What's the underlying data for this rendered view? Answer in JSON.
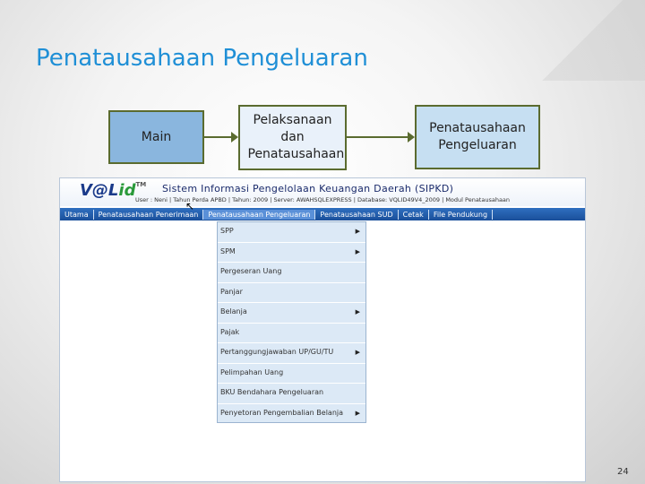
{
  "slide": {
    "title": "Penatausahaan Pengeluaran",
    "page_number": "24",
    "flow": [
      "Main",
      "Pelaksanaan dan Penatausahaan",
      "Penatausahaan Pengeluaran"
    ]
  },
  "app": {
    "logo_main": "V@L",
    "logo_accent": "id",
    "logo_tm": "TM",
    "title": "Sistem Informasi Pengelolaan Keuangan Daerah (SIPKD)",
    "user_info": "User : Neni  |  Tahun Perda APBD  |  Tahun: 2009  |  Server: AWAHSQLEXPRESS  |  Database: VQLID49V4_2009  |  Modul Penatausahaan",
    "menu": [
      "Utama",
      "Penatausahaan Penerimaan",
      "Penatausahaan Pengeluaran",
      "Penatausahaan SUD",
      "Cetak",
      "File Pendukung"
    ],
    "active_menu_index": 2,
    "dropdown": [
      {
        "label": "SPP",
        "submenu": true
      },
      {
        "label": "SPM",
        "submenu": true
      },
      {
        "label": "Pergeseran Uang",
        "submenu": false
      },
      {
        "label": "Panjar",
        "submenu": false
      },
      {
        "label": "Belanja",
        "submenu": true
      },
      {
        "label": "Pajak",
        "submenu": false
      },
      {
        "label": "Pertanggungjawaban UP/GU/TU",
        "submenu": true
      },
      {
        "label": "Pelimpahan Uang",
        "submenu": false
      },
      {
        "label": "BKU Bendahara Pengeluaran",
        "submenu": false
      },
      {
        "label": "Penyetoran Pengembalian Belanja",
        "submenu": true
      }
    ]
  },
  "colors": {
    "title": "#1f8fd6",
    "menu_bar": "#1a4f9a",
    "dropdown_bg": "#dce9f6",
    "box_border": "#5a6b2f"
  }
}
